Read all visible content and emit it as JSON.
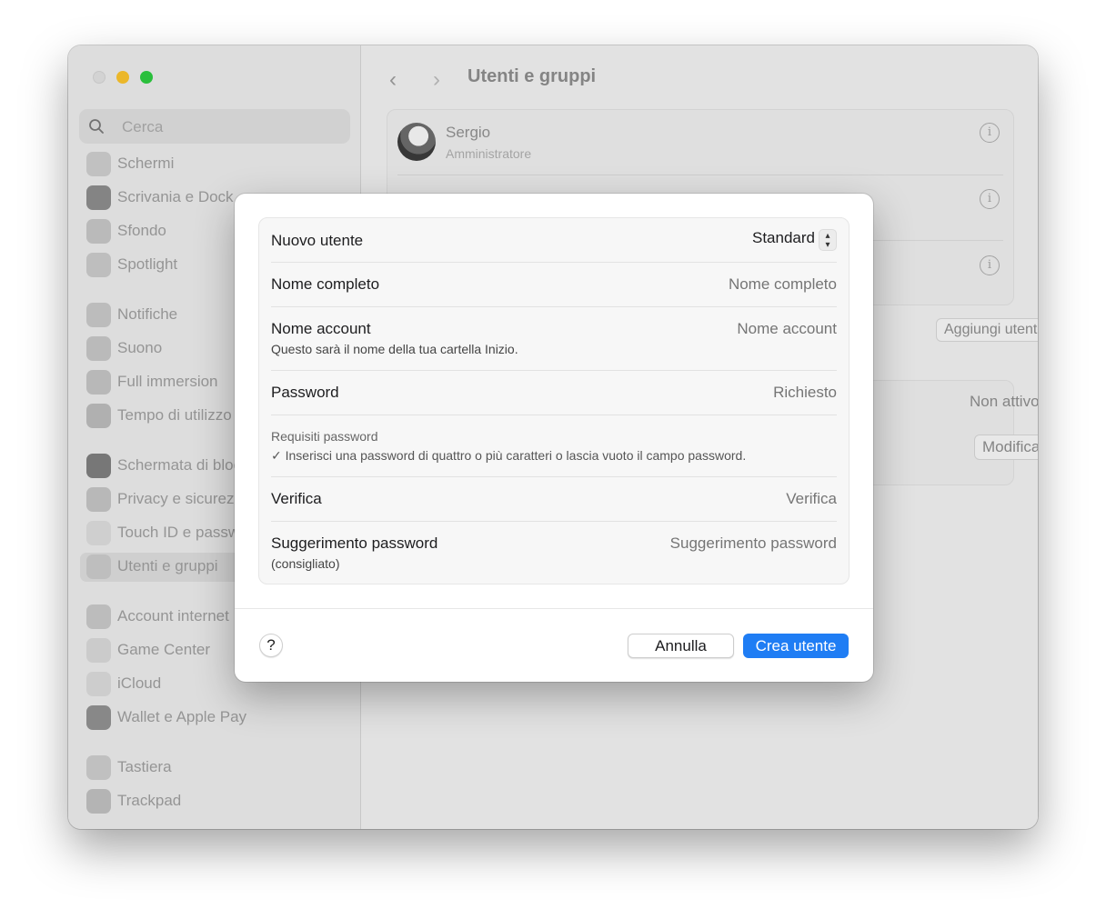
{
  "sidebar": {
    "search_placeholder": "Cerca",
    "items": [
      {
        "label": "Schermi",
        "icon": "display-icon",
        "color": "#c9c9c9"
      },
      {
        "label": "Scrivania e Dock",
        "icon": "dock-icon",
        "color": "#8a8a8a"
      },
      {
        "label": "Sfondo",
        "icon": "wallpaper-icon",
        "color": "#c2c2c2"
      },
      {
        "label": "Spotlight",
        "icon": "spotlight-icon",
        "color": "#c6c6c6"
      },
      {
        "label": "Notifiche",
        "icon": "bell-icon",
        "color": "#c4c4c4"
      },
      {
        "label": "Suono",
        "icon": "speaker-icon",
        "color": "#c2c2c2"
      },
      {
        "label": "Full immersion",
        "icon": "moon-icon",
        "color": "#c0c0c0"
      },
      {
        "label": "Tempo di utilizzo",
        "icon": "hourglass-icon",
        "color": "#b8b8b8"
      },
      {
        "label": "Schermata di blocco",
        "icon": "lock-icon",
        "color": "#7c7c7c"
      },
      {
        "label": "Privacy e sicurezza",
        "icon": "hand-icon",
        "color": "#c0c0c0"
      },
      {
        "label": "Touch ID e password",
        "icon": "fingerprint-icon",
        "color": "#d8d8d8"
      },
      {
        "label": "Utenti e gruppi",
        "icon": "users-icon",
        "color": "#c6c6c6"
      },
      {
        "label": "Account internet",
        "icon": "at-icon",
        "color": "#c4c4c4"
      },
      {
        "label": "Game Center",
        "icon": "game-center-icon",
        "color": "#d4d4d4"
      },
      {
        "label": "iCloud",
        "icon": "cloud-icon",
        "color": "#d6d6d6"
      },
      {
        "label": "Wallet e Apple Pay",
        "icon": "wallet-icon",
        "color": "#8e8e8e"
      },
      {
        "label": "Tastiera",
        "icon": "keyboard-icon",
        "color": "#c8c8c8"
      },
      {
        "label": "Trackpad",
        "icon": "trackpad-icon",
        "color": "#bcbcbc"
      }
    ]
  },
  "main": {
    "title": "Utenti e gruppi",
    "user": {
      "name": "Sergio",
      "role": "Amministratore"
    },
    "add_user_button": "Aggiungi utente…",
    "auto_login_value": "Non attivo",
    "edit_button": "Modifica…",
    "help": "?"
  },
  "dialog": {
    "new_user_label": "Nuovo utente",
    "account_type": "Standard",
    "full_name": {
      "label": "Nome completo",
      "placeholder": "Nome completo"
    },
    "account_name": {
      "label": "Nome account",
      "placeholder": "Nome account",
      "hint": "Questo sarà il nome della tua cartella Inizio."
    },
    "password": {
      "label": "Password",
      "placeholder": "Richiesto"
    },
    "requirements": {
      "title": "Requisiti password",
      "line": "✓ Inserisci una password di quattro o più caratteri o lascia vuoto il campo password."
    },
    "verify": {
      "label": "Verifica",
      "placeholder": "Verifica"
    },
    "hint": {
      "label": "Suggerimento password",
      "sub": "(consigliato)",
      "placeholder": "Suggerimento password"
    },
    "help": "?",
    "cancel": "Annulla",
    "create": "Crea utente",
    "accent": "#1f7df4"
  }
}
